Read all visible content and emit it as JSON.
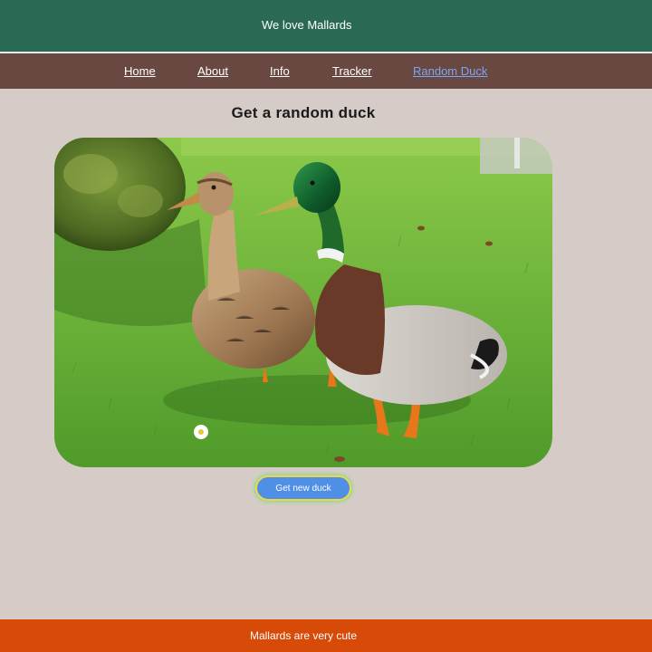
{
  "header": {
    "title": "We love Mallards"
  },
  "nav": {
    "items": [
      {
        "label": "Home"
      },
      {
        "label": "About"
      },
      {
        "label": "Info"
      },
      {
        "label": "Tracker"
      },
      {
        "label": "Random Duck",
        "active": true
      }
    ]
  },
  "main": {
    "heading": "Get a random duck",
    "image_subject": "two mallard ducks (female and male) standing on grass",
    "button_label": "Get new duck"
  },
  "footer": {
    "text": "Mallards are very cute"
  },
  "colors": {
    "header_bg": "#2a6a54",
    "nav_bg": "#6a4842",
    "page_bg": "#d6ccc7",
    "footer_bg": "#d84a08",
    "active_link": "#7aa6f0",
    "button_bg": "#4f8fe6"
  }
}
